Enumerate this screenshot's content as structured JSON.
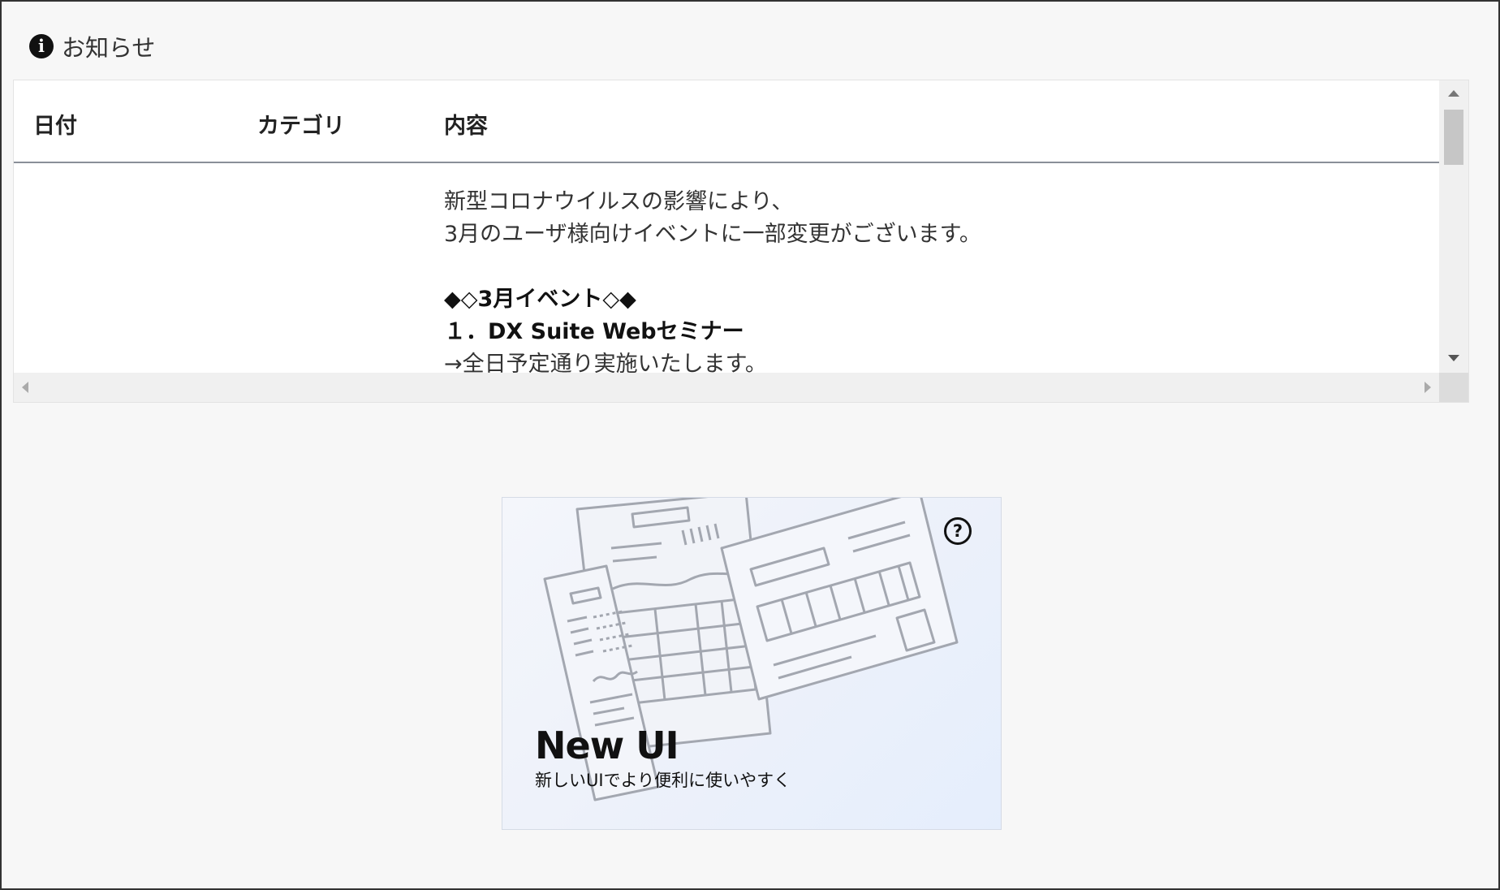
{
  "notice": {
    "title": "お知らせ",
    "icon": "info-icon",
    "columns": {
      "date": "日付",
      "category": "カテゴリ",
      "content": "内容"
    },
    "rows": [
      {
        "date": "",
        "category": "",
        "content_lines": [
          "新型コロナウイルスの影響により、",
          "3月のユーザ様向けイベントに一部変更がございます。",
          "",
          "◆◇3月イベント◇◆",
          "１．DX Suite Webセミナー",
          "→全日予定通り実施いたします。"
        ]
      }
    ]
  },
  "banner": {
    "title": "New UI",
    "subtitle": "新しいUIでより便利に使いやすく",
    "help_icon": "question-circle-icon"
  },
  "colors": {
    "page_bg": "#f7f7f7",
    "frame_border": "#333333",
    "header_rule": "#8a8f98",
    "scrollbar_track": "#f0f0f0",
    "scrollbar_thumb": "#c6c6c6",
    "banner_bg": "#edf1fa"
  }
}
